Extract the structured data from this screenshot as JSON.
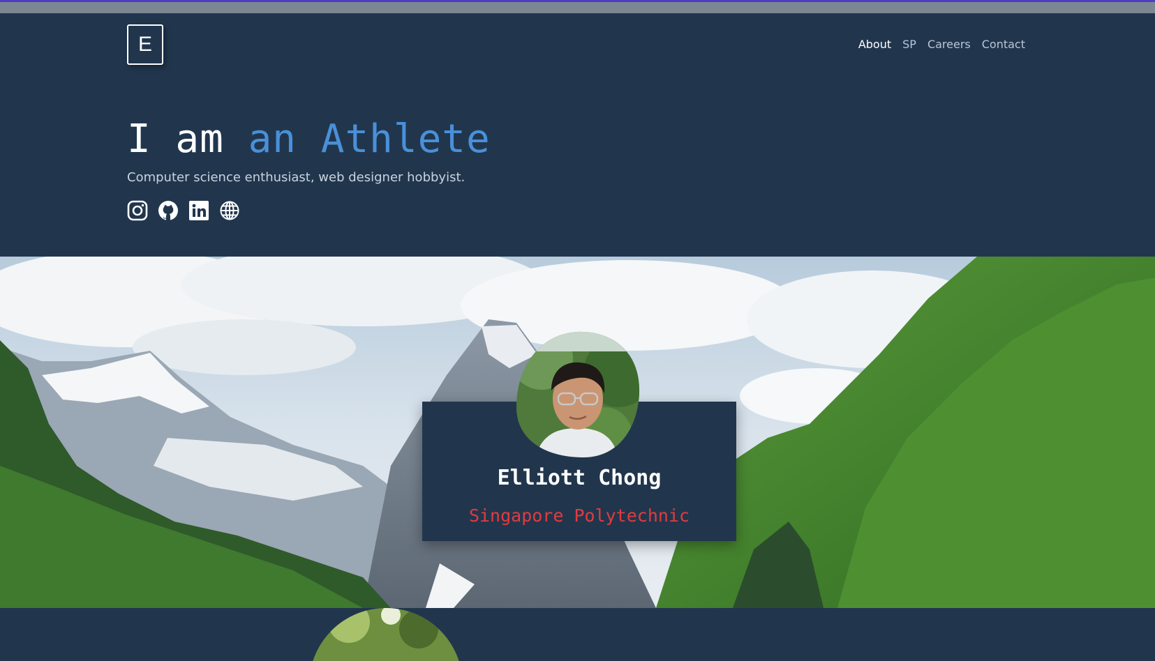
{
  "header": {
    "logo_letter": "E",
    "nav": [
      {
        "label": "About"
      },
      {
        "label": "SP"
      },
      {
        "label": "Careers"
      },
      {
        "label": "Contact"
      }
    ],
    "headline_prefix": "I am ",
    "headline_accent": "an Athlete",
    "subtitle": "Computer science enthusiast, web designer hobbyist.",
    "social_icons": [
      "instagram-icon",
      "github-icon",
      "linkedin-icon",
      "globe-icon"
    ]
  },
  "profile": {
    "name": "Elliott Chong",
    "school": "Singapore Polytechnic"
  },
  "colors": {
    "background": "#21364d",
    "accent": "#4a90d9",
    "school_text": "#e23b40",
    "top_accent": "#4b3fc0"
  }
}
